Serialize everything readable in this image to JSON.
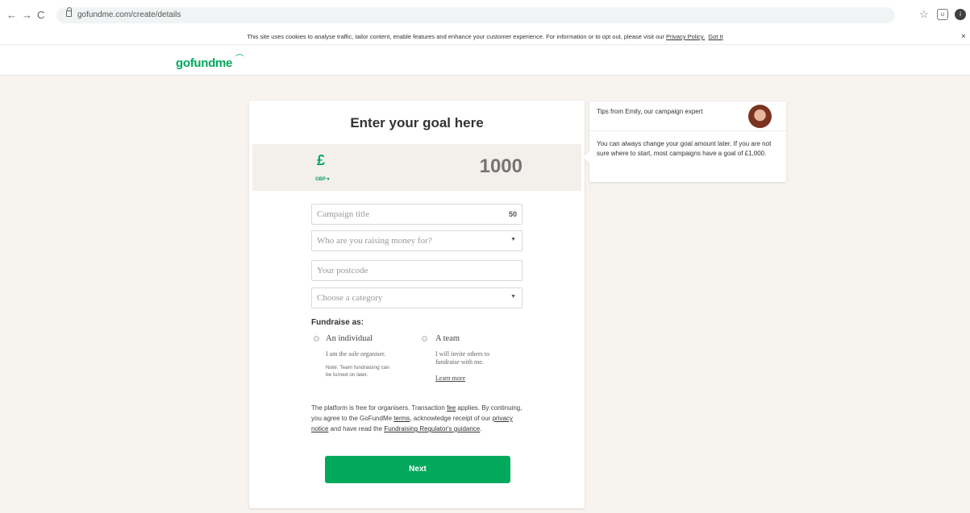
{
  "browser": {
    "url": "gofundme.com/create/details",
    "back_icon": "←",
    "forward_icon": "→",
    "reload_icon": "C",
    "star_icon": "☆",
    "extension_icon": "ʊ",
    "profile_initial": "i"
  },
  "cookie_bar": {
    "text": "This site uses cookies to analyse traffic, tailor content, enable features and enhance your customer experience. For information or to opt out, please visit our ",
    "privacy_link": "Privacy Policy.",
    "got_it": "Got It",
    "close": "×"
  },
  "header": {
    "logo_text": "gofundme",
    "logo_mark": "⌒"
  },
  "form": {
    "title": "Enter your goal here",
    "currency_symbol": "£",
    "currency_code": "GBP ▾",
    "goal_placeholder": "1000",
    "campaign_title_placeholder": "Campaign title",
    "campaign_title_count": "50",
    "beneficiary_placeholder": "Who are you raising money for?",
    "postcode_placeholder": "Your postcode",
    "category_placeholder": "Choose a category",
    "caret": "▼",
    "fundraise_as_label": "Fundraise as:",
    "individual": {
      "title": "An individual",
      "subtitle": "I am the sole organiser.",
      "note_line1": "Note: Team fundraising can",
      "note_line2": "be turned on later."
    },
    "team": {
      "title": "A team",
      "subtitle_line1": "I will invite others to",
      "subtitle_line2": "fundraise with me.",
      "learn_more": "Learn more"
    },
    "terms": {
      "t1": "The platform is free for organisers. Transaction ",
      "fee": "fee",
      "t2": " applies. By continuing, you agree to the GoFundMe ",
      "terms_link": "terms",
      "t3": ", acknowledge receipt of our ",
      "privacy_link": "privacy notice",
      "t4": " and have read the ",
      "regulator_link": "Fundraising Regulator's guidance",
      "t5": "."
    },
    "next_label": "Next"
  },
  "tips": {
    "title": "Tips from Emily, our campaign expert",
    "body": "You can always change your goal amount later. If you are not sure where to start, most campaigns have a goal of £1,000."
  },
  "colors": {
    "brand_green": "#02a95c",
    "page_background": "#f7f3ef"
  }
}
